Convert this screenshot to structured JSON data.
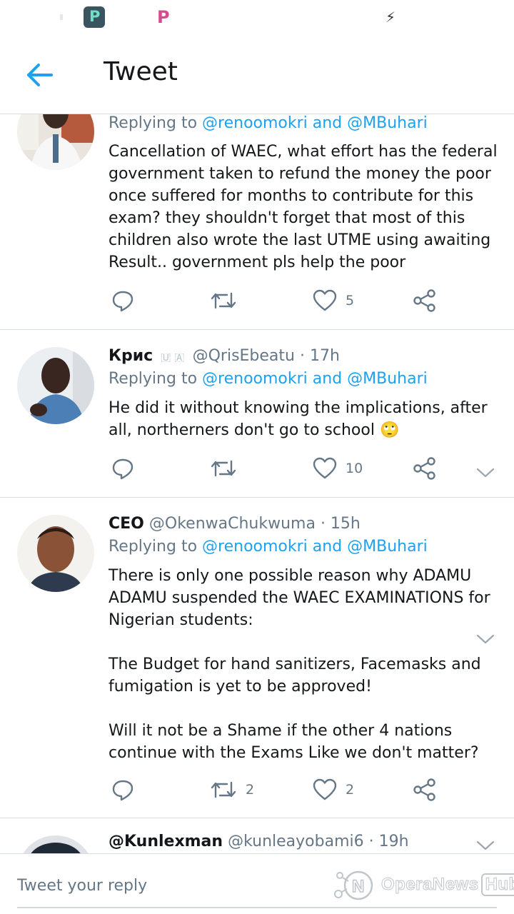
{
  "header": {
    "title": "Tweet"
  },
  "reply_label": "Replying to",
  "tweets": [
    {
      "replying_mentions": "@renoomokri and @MBuhari",
      "text": "Cancellation of WAEC, what effort has the federal government taken to refund the money the poor once suffered for months to contribute for this exam? they shouldn't forget that most of this children also wrote the last UTME using awaiting Result.. government pls help the poor",
      "reply_count": "",
      "retweet_count": "",
      "like_count": "5"
    },
    {
      "display_name": "Крис",
      "badges": "🇺 🇦",
      "handle_time": "@QrisEbeatu · 17h",
      "replying_mentions": "@renoomokri and @MBuhari",
      "text": "He did it without knowing the implications, after all, northerners don't go to school 🙄",
      "reply_count": "",
      "retweet_count": "",
      "like_count": "10"
    },
    {
      "display_name": "CEO",
      "handle_time": "@OkenwaChukwuma · 15h",
      "replying_mentions": "@renoomokri and @MBuhari",
      "text": "There is only one possible reason why ADAMU ADAMU suspended the WAEC EXAMINATIONS for Nigerian students:\n\nThe Budget for hand sanitizers, Facemasks and fumigation is yet to be approved!\n\nWill it not be a Shame if the other 4 nations continue with the Exams Like we don't matter?",
      "reply_count": "",
      "retweet_count": "2",
      "like_count": "2"
    },
    {
      "display_name": "@Kunlexman",
      "handle_time": "@kunleayobami6 · 19h"
    }
  ],
  "reply_bar": {
    "placeholder": "Tweet your reply"
  },
  "watermark": {
    "text": "OperaNews",
    "hub": "Hub"
  },
  "colors": {
    "accent": "#1da1f2",
    "secondary_text": "#657786",
    "divider": "#d8dde1"
  },
  "icons": [
    "arrow-left-icon",
    "reply-icon",
    "retweet-icon",
    "heart-icon",
    "share-icon",
    "chevron-down-icon"
  ]
}
